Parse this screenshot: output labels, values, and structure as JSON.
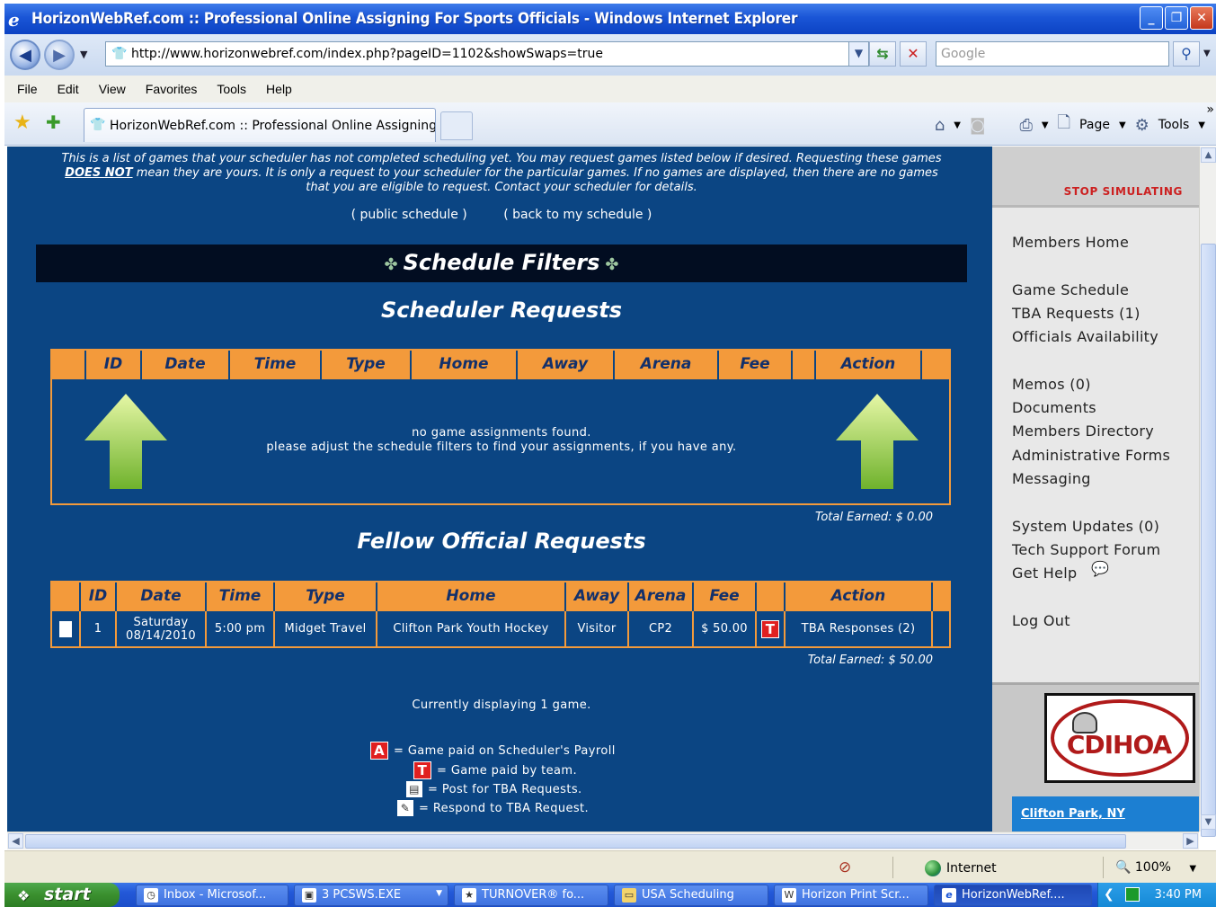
{
  "window": {
    "title": "HorizonWebRef.com :: Professional Online Assigning For Sports Officials - Windows Internet Explorer"
  },
  "address": {
    "url": "http://www.horizonwebref.com/index.php?pageID=1102&showSwaps=true",
    "search_placeholder": "Google"
  },
  "menu": [
    "File",
    "Edit",
    "View",
    "Favorites",
    "Tools",
    "Help"
  ],
  "tab": {
    "title": "HorizonWebRef.com :: Professional Online Assigning ..."
  },
  "commandbar": {
    "page_label": "Page",
    "tools_label": "Tools"
  },
  "intro": {
    "line1": "This is a list of games that your scheduler has not completed scheduling yet. You may request games listed below if desired. Requesting these games",
    "emph": "DOES NOT",
    "line2": " mean they are yours. It is only a request to your scheduler for the particular games. If no games are displayed, then there are no games",
    "line3": "that you are eligible to request. Contact your scheduler for details."
  },
  "links": {
    "public_schedule": "( public schedule )",
    "back_schedule": "( back to my schedule )"
  },
  "filters_title": "Schedule Filters",
  "scheduler_requests": {
    "title": "Scheduler Requests",
    "columns": [
      "",
      "ID",
      "Date",
      "Time",
      "Type",
      "Home",
      "Away",
      "Arena",
      "Fee",
      "",
      "Action",
      ""
    ],
    "empty_line1": "no game assignments found.",
    "empty_line2": "please adjust the schedule filters to find your assignments, if you have any.",
    "total": "Total Earned:  $ 0.00"
  },
  "fellow_requests": {
    "title": "Fellow Official Requests",
    "columns": [
      "",
      "ID",
      "Date",
      "Time",
      "Type",
      "Home",
      "Away",
      "Arena",
      "Fee",
      "",
      "Action",
      ""
    ],
    "rows": [
      {
        "id": "1",
        "date_day": "Saturday",
        "date": "08/14/2010",
        "time": "5:00 pm",
        "type": "Midget Travel",
        "home": "Clifton Park Youth Hockey",
        "away": "Visitor",
        "arena": "CP2",
        "fee": "$ 50.00",
        "badge": "T",
        "action": "TBA Responses  (2)"
      }
    ],
    "total": "Total Earned:  $ 50.00"
  },
  "displaying": "Currently displaying 1 game.",
  "legend": {
    "a_badge": "A",
    "a_text": "= Game paid on Scheduler's Payroll",
    "t_badge": "T",
    "t_text": "= Game paid by team.",
    "post_text": "= Post for TBA Requests.",
    "respond_text": "= Respond to TBA Request."
  },
  "sidebar": {
    "stop": "STOP SIMULATING",
    "items": [
      "Members Home",
      "",
      "Game Schedule",
      "TBA Requests (1)",
      "Officials Availability",
      "",
      "Memos (0)",
      "Documents",
      "Members Directory",
      "Administrative Forms",
      "Messaging",
      "",
      "System Updates (0)",
      "Tech Support Forum",
      "Get Help",
      "",
      "Log Out"
    ],
    "logo_text": "CDIHOA",
    "city": "Clifton Park, NY"
  },
  "status": {
    "zone": "Internet",
    "zoom": "100%"
  },
  "taskbar": {
    "start": "start",
    "buttons": [
      "Inbox - Microsof...",
      "3 PCSWS.EXE",
      "TURNOVER® fo...",
      "USA Scheduling",
      "Horizon Print Scr...",
      "HorizonWebRef...."
    ],
    "clock": "3:40 PM"
  }
}
